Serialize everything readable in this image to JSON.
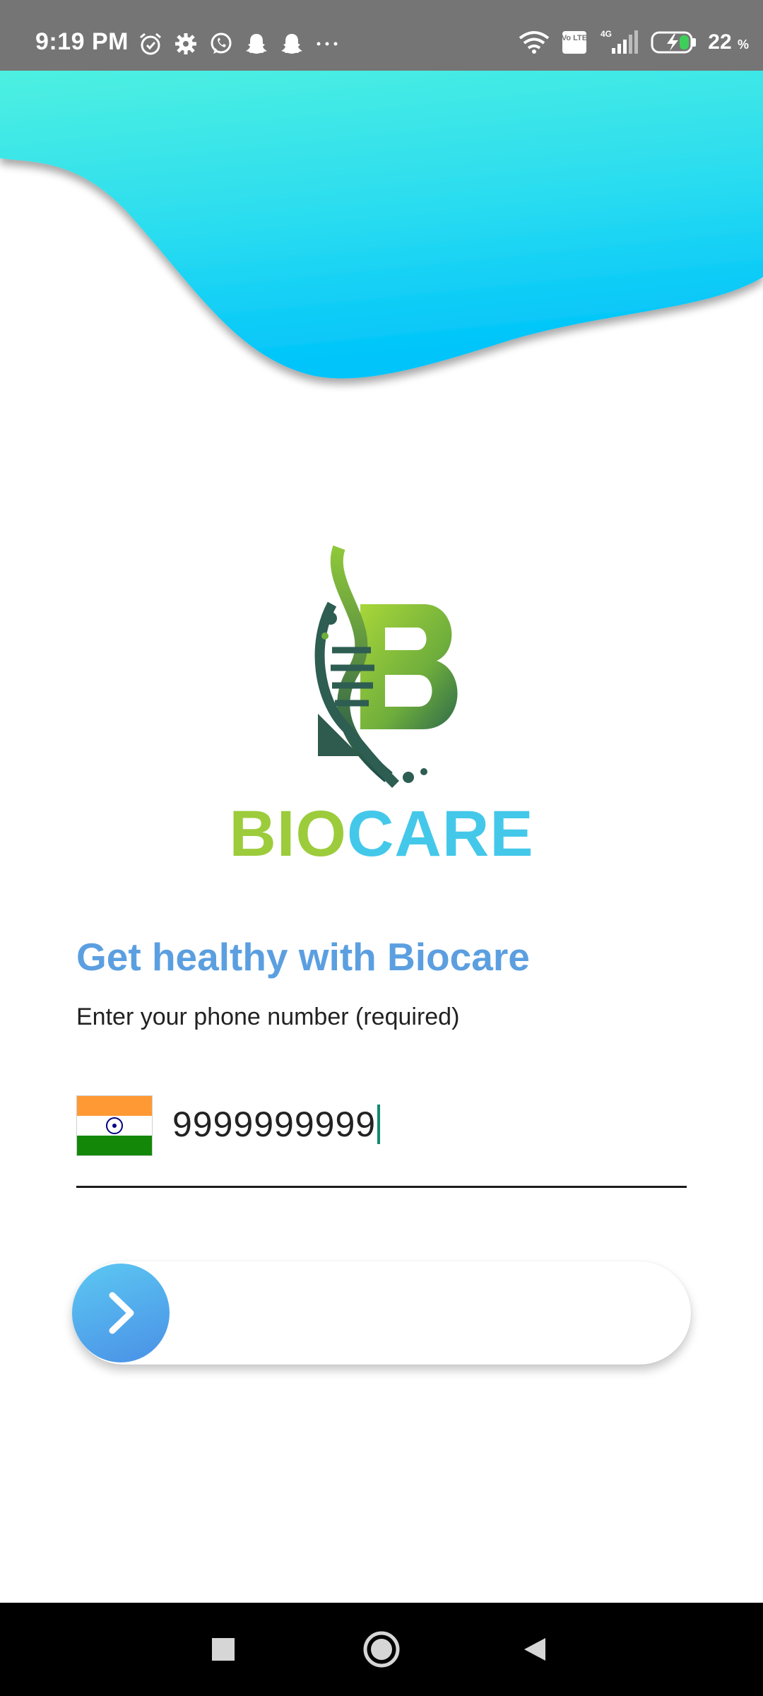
{
  "status_bar": {
    "time": "9:19 PM",
    "left_icons": [
      "alarm-icon",
      "gear-icon",
      "whatsapp-icon",
      "snapchat-icon",
      "snapchat-icon",
      "more-dots-icon"
    ],
    "right_icons": [
      "wifi-icon",
      "volte-icon",
      "signal-4g-icon",
      "battery-charging-icon"
    ],
    "network_label": "4G",
    "volte_label": "Vo LTE",
    "battery_percent": "22",
    "battery_unit": "%"
  },
  "brand": {
    "name_part1": "BIO",
    "name_part2": "CARE",
    "colors": {
      "green": "#9ccc3b",
      "blue": "#44c8ea"
    }
  },
  "form": {
    "headline": "Get healthy with Biocare",
    "subline": "Enter your phone number (required)",
    "country_flag": "india-flag-icon",
    "phone_value": "9999999999"
  },
  "slide_button": {
    "icon": "chevron-right-icon"
  },
  "nav_bar": {
    "items": [
      "recents-square-icon",
      "home-circle-icon",
      "back-triangle-icon"
    ]
  },
  "colors": {
    "wave_top": "#4ef0e0",
    "wave_bottom": "#00c4fa",
    "headline": "#5b9fe0",
    "knob": "#4a90e6"
  }
}
